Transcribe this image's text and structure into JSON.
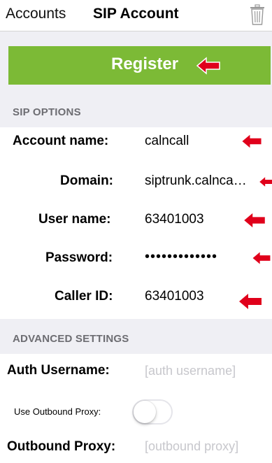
{
  "navbar": {
    "back_label": "Accounts",
    "title": "SIP Account",
    "delete_icon": "trash-icon"
  },
  "register": {
    "label": "Register",
    "color": "#7cba36"
  },
  "annotation": {
    "arrow_color": "#e0001b",
    "arrow_icon": "left-arrow-icon"
  },
  "sip_options": {
    "header": "SIP OPTIONS",
    "account_name": {
      "label": "Account name:",
      "value": "calncall"
    },
    "domain": {
      "label": "Domain:",
      "value": "siptrunk.calnca…"
    },
    "user_name": {
      "label": "User name:",
      "value": "63401003"
    },
    "password": {
      "label": "Password:",
      "value": "•••••••••••••"
    },
    "caller_id": {
      "label": "Caller ID:",
      "value": "63401003"
    }
  },
  "advanced": {
    "header": "ADVANCED SETTINGS",
    "auth_username": {
      "label": "Auth Username:",
      "placeholder": "[auth username]"
    },
    "use_outbound_proxy": {
      "label": "Use Outbound Proxy:",
      "enabled": false
    },
    "outbound_proxy": {
      "label": "Outbound Proxy:",
      "placeholder": "[outbound proxy]"
    }
  }
}
